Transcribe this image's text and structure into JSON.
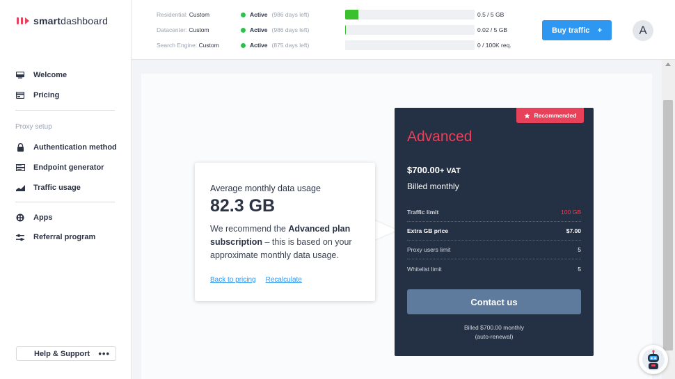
{
  "app": {
    "logo_text_bold": "smart",
    "logo_text": "dashboard"
  },
  "sidebar": {
    "items_top": [
      {
        "label": "Welcome",
        "icon": "monitor-icon"
      },
      {
        "label": "Pricing",
        "icon": "pricing-card-icon"
      }
    ],
    "section_label": "Proxy setup",
    "items_proxy": [
      {
        "label": "Authentication method",
        "icon": "lock-icon"
      },
      {
        "label": "Endpoint generator",
        "icon": "server-icon"
      },
      {
        "label": "Traffic usage",
        "icon": "chart-area-icon"
      }
    ],
    "items_bottom": [
      {
        "label": "Apps",
        "icon": "apps-grid-icon"
      },
      {
        "label": "Referral program",
        "icon": "sliders-icon"
      }
    ],
    "help_label": "Help & Support",
    "help_more": "•••"
  },
  "topbar": {
    "rows": [
      {
        "type": "Residential:",
        "plan": "Custom",
        "status": "Active",
        "days": "(986 days left)",
        "usage": "0.5 / 5 GB",
        "progress": 0.1
      },
      {
        "type": "Datacenter:",
        "plan": "Custom",
        "status": "Active",
        "days": "(986 days left)",
        "usage": "0.02 / 5 GB",
        "progress": 0.004
      },
      {
        "type": "Search Engine:",
        "plan": "Custom",
        "status": "Active",
        "days": "(875 days left)",
        "usage": "0 / 100K req.",
        "progress": 0
      }
    ],
    "buy_label": "Buy traffic",
    "buy_plus": "+",
    "avatar_letter": "A",
    "status_color": "#2fbf4d",
    "progress_color": "#3bc12d"
  },
  "usage": {
    "title": "Average monthly data usage",
    "value": "82.3 GB",
    "text_1": "We recommend the ",
    "text_bold": "Advanced plan subscription",
    "text_2": " – this is based on your approximate monthly data usage.",
    "link_back": "Back to pricing",
    "link_recalc": "Recalculate"
  },
  "plan": {
    "badge": "Recommended",
    "name": "Advanced",
    "price": "$700.00",
    "price_suffix": "+ VAT",
    "billing": "Billed monthly",
    "specs": [
      {
        "key": "Traffic limit",
        "value": "100 GB",
        "highlight": true
      },
      {
        "key": "Extra GB price",
        "value": "$7.00",
        "highlight": false
      },
      {
        "key": "Proxy users limit",
        "value": "5",
        "highlight": false
      },
      {
        "key": "Whitelist limit",
        "value": "5",
        "highlight": false
      }
    ],
    "cta": "Contact us",
    "foot_1": "Billed $700.00 monthly",
    "foot_2": "(auto-renewal)",
    "accent_color": "#e8425a",
    "card_color": "#243044"
  },
  "chat": {
    "icon": "chat-robot-icon"
  }
}
